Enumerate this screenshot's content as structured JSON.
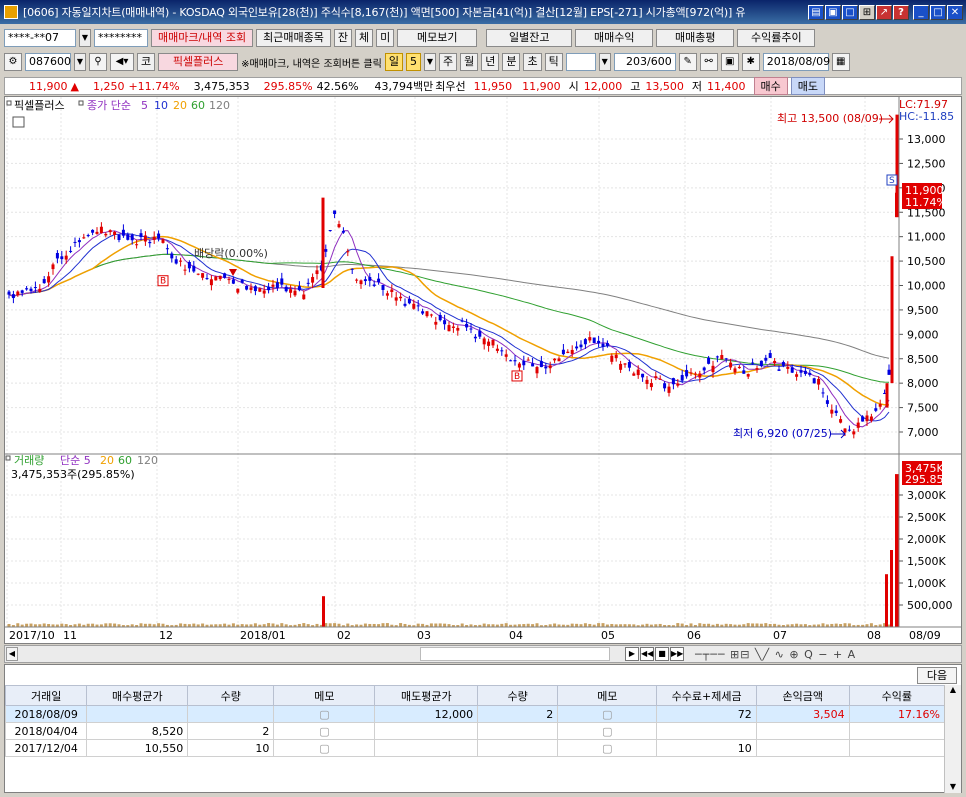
{
  "window": {
    "title": "[0606] 자동일지차트(매매내역) - KOSDAQ 외국인보유[28(천)] 주식수[8,167(천)] 액면[500] 자본금[41(억)] 결산[12월] EPS[-271] 시가총액[972(억)] 유"
  },
  "toolbar1": {
    "account": "****-**07",
    "password": "********",
    "btn_mark": "매매마크/내역 조회",
    "btn_recent": "최근매매종목",
    "btn_jan": "잔",
    "btn_che": "체",
    "btn_mi": "미",
    "btn_memo": "메모보기",
    "btn_daily": "일별잔고",
    "btn_profit": "매매수익",
    "btn_eval": "매매총평",
    "btn_rate": "수익률추이"
  },
  "toolbar2": {
    "code": "087600",
    "name_tag": "코",
    "name": "픽셀플러스",
    "notice": "※매매마크, 내역은 조회버튼 클릭",
    "period_day": "일",
    "period_num": "5",
    "p_week": "주",
    "p_month": "월",
    "p_year": "년",
    "p_min": "분",
    "p_sec": "초",
    "p_tick": "틱",
    "count": "203",
    "count_max": "/600",
    "date": "2018/08/09"
  },
  "pricebar": {
    "price": "11,900",
    "arrow": "▲",
    "change": "1,250",
    "change_pct": "+11.74%",
    "volume": "3,475,353",
    "vol_pct1": "295.85%",
    "vol_pct2": "42.56%",
    "amount": "43,794백만",
    "best_label": "최우선",
    "ask": "11,950",
    "bid": "11,900",
    "open_label": "시",
    "open": "12,000",
    "high_label": "고",
    "high": "13,500",
    "low_label": "저",
    "low": "11,400",
    "buy": "매수",
    "sell": "매도"
  },
  "chart": {
    "legend_name": "픽셀플러스",
    "legend_ma": "종가 단순",
    "ma5": "5",
    "ma10": "10",
    "ma20": "20",
    "ma60": "60",
    "ma120": "120",
    "lc": "LC:71.97",
    "hc": "HC:-11.85",
    "high_note": "최고 13,500 (08/09)",
    "low_note": "최저 6,920 (07/25)",
    "dividend_note": "배당락(0.00%)",
    "price_box": "11,900",
    "price_box_pct": "11.74%",
    "y_ticks": [
      "13,000",
      "12,500",
      "12,000",
      "11,500",
      "11,000",
      "10,500",
      "10,000",
      "9,500",
      "9,000",
      "8,500",
      "8,000",
      "7,500",
      "7,000"
    ],
    "vol_legend": "거래량",
    "vol_ma": "단순 5",
    "vol_ma20": "20",
    "vol_ma60": "60",
    "vol_ma120": "120",
    "vol_value": "3,475,353주(295.85%)",
    "vol_box": "3,475K",
    "vol_box_pct": "295.85%",
    "vol_ticks": [
      "3,000K",
      "2,500K",
      "2,000K",
      "1,500K",
      "1,000K",
      "500,000"
    ],
    "x_ticks": [
      "2017/10",
      "11",
      "12",
      "2018/01",
      "02",
      "03",
      "04",
      "05",
      "06",
      "07",
      "08",
      "08/09"
    ],
    "marker_b": "B",
    "marker_s": "S",
    "colors": {
      "up": "#e00000",
      "down": "#0000e0",
      "ma5": "#9030c0",
      "ma10": "#2030d0",
      "ma20": "#f0a000",
      "ma60": "#30a030",
      "ma120": "#808080"
    }
  },
  "grid": {
    "next_btn": "다음",
    "headers": [
      "거래일",
      "매수평균가",
      "수량",
      "메모",
      "매도평균가",
      "수량",
      "메모",
      "수수료+제세금",
      "손익금액",
      "수익률"
    ],
    "rows": [
      {
        "date": "2018/08/09",
        "buy_avg": "",
        "buy_qty": "",
        "sell_avg": "12,000",
        "sell_qty": "2",
        "fee": "72",
        "pl": "3,504",
        "rate": "17.16%"
      },
      {
        "date": "2018/04/04",
        "buy_avg": "8,520",
        "buy_qty": "2",
        "sell_avg": "",
        "sell_qty": "",
        "fee": "",
        "pl": "",
        "rate": ""
      },
      {
        "date": "2017/12/04",
        "buy_avg": "10,550",
        "buy_qty": "10",
        "sell_avg": "",
        "sell_qty": "",
        "fee": "10",
        "pl": "",
        "rate": ""
      }
    ]
  }
}
